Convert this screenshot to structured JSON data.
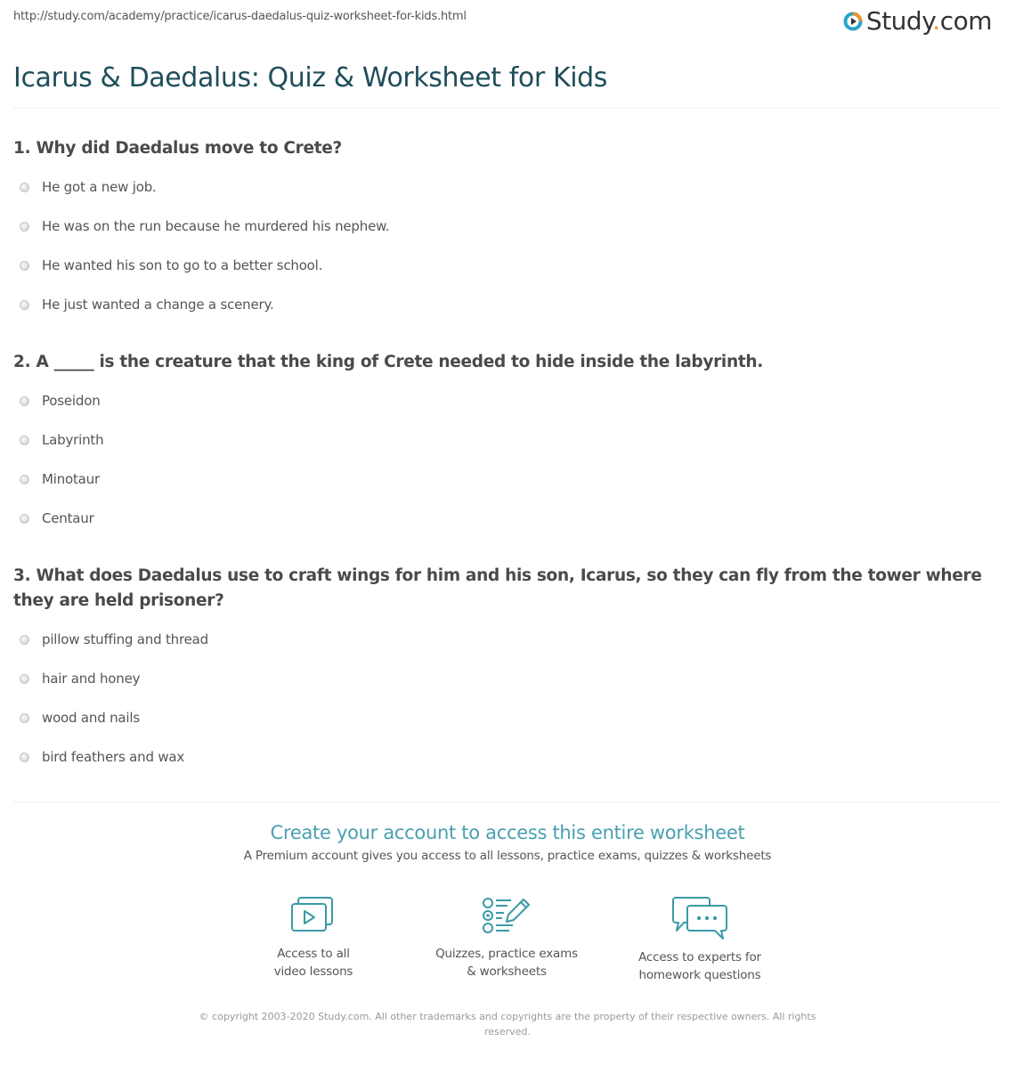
{
  "header": {
    "url": "http://study.com/academy/practice/icarus-daedalus-quiz-worksheet-for-kids.html",
    "logo": {
      "name": "Study",
      "dot": ".",
      "tld": "com",
      "icon": "play-circle-icon",
      "accent_color": "#f0932b",
      "icon_color": "#2aa3c8"
    }
  },
  "page": {
    "title": "Icarus & Daedalus: Quiz & Worksheet for Kids",
    "title_color": "#1f4e5a"
  },
  "questions": [
    {
      "text": "1. Why did Daedalus move to Crete?",
      "options": [
        "He got a new job.",
        "He was on the run because he murdered his nephew.",
        "He wanted his son to go to a better school.",
        "He just wanted a change a scenery."
      ]
    },
    {
      "text": "2. A _____ is the creature that the king of Crete needed to hide inside the labyrinth.",
      "options": [
        "Poseidon",
        "Labyrinth",
        "Minotaur",
        "Centaur"
      ]
    },
    {
      "text": "3. What does Daedalus use to craft wings for him and his son, Icarus, so they can fly from the tower where they are held prisoner?",
      "options": [
        "pillow stuffing and thread",
        "hair and honey",
        "wood and nails",
        "bird feathers and wax"
      ]
    }
  ],
  "cta": {
    "title": "Create your account to access this entire worksheet",
    "subtitle": "A Premium account gives you access to all lessons, practice exams, quizzes & worksheets",
    "accent_color": "#4a9fb0",
    "features": [
      {
        "icon": "video-lessons-icon",
        "line1": "Access to all",
        "line2": "video lessons"
      },
      {
        "icon": "quiz-checklist-icon",
        "line1": "Quizzes, practice exams",
        "line2": "& worksheets"
      },
      {
        "icon": "chat-bubbles-icon",
        "line1": "Access to experts for",
        "line2": "homework questions"
      }
    ]
  },
  "footer": {
    "copyright": "© copyright 2003-2020 Study.com. All other trademarks and copyrights are the property of their respective owners. All rights reserved."
  }
}
